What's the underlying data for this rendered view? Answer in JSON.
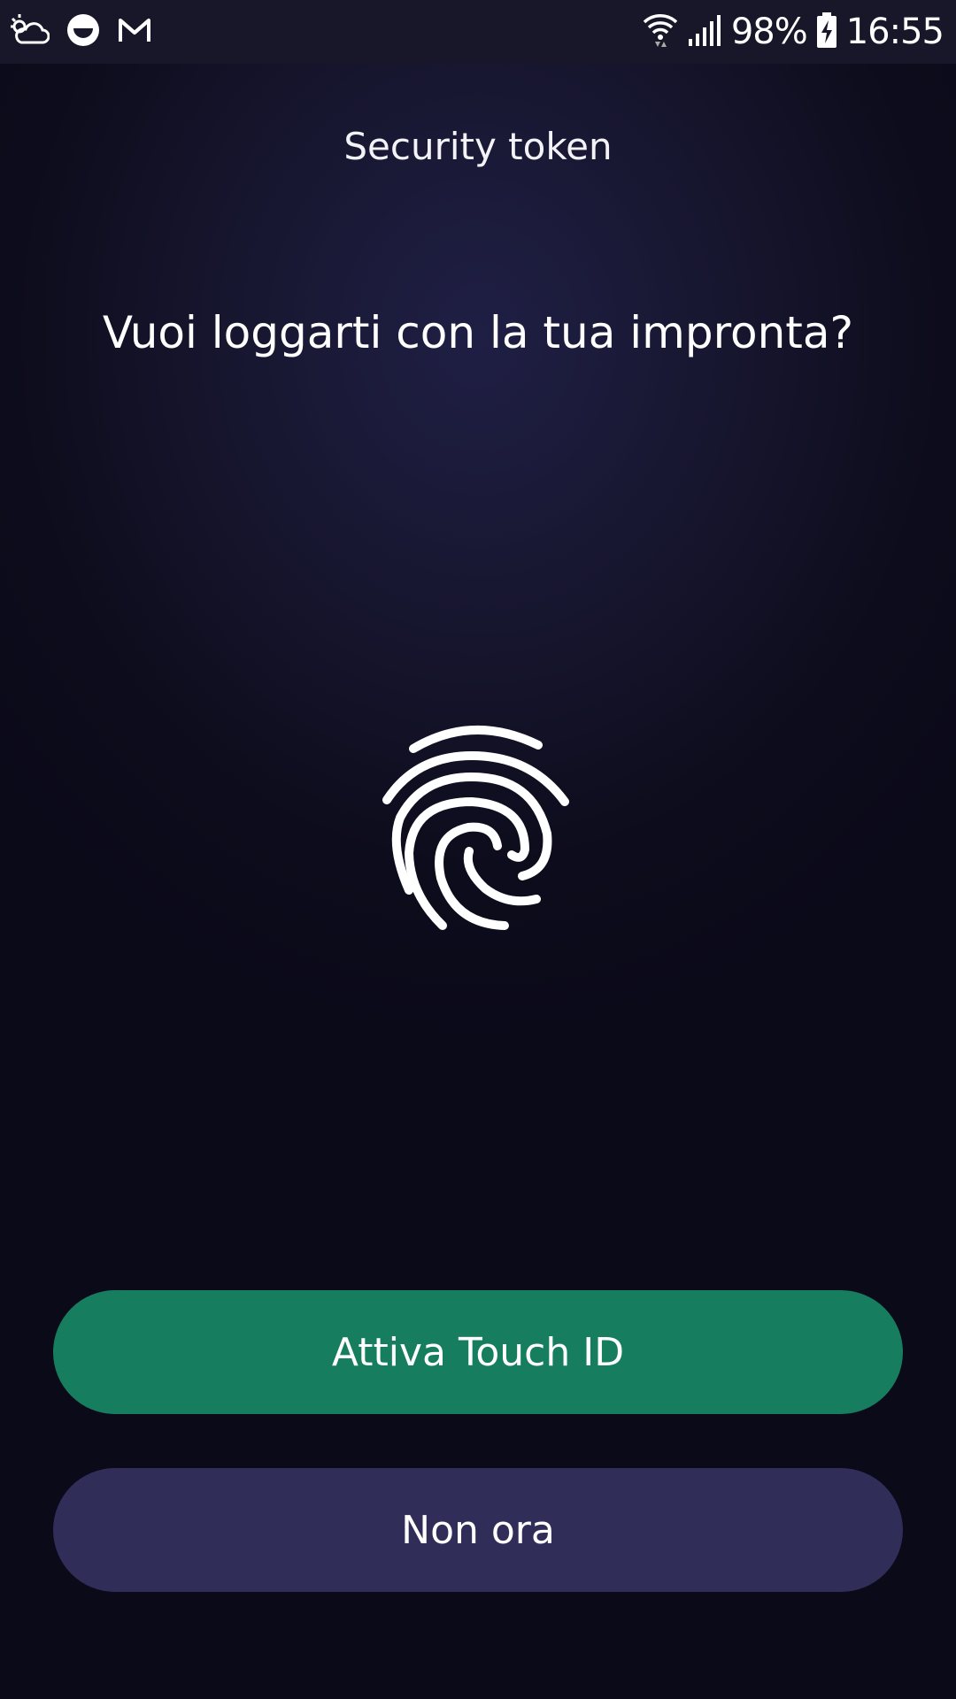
{
  "status_bar": {
    "battery": "98%",
    "time": "16:55",
    "left_icons": [
      "weather-icon",
      "smiley-icon",
      "gmail-icon"
    ],
    "right_icons": [
      "wifi-icon",
      "signal-icon",
      "battery-charging-icon"
    ]
  },
  "screen": {
    "title": "Security token",
    "question": "Vuoi loggarti con la tua impronta?",
    "icon": "fingerprint-icon"
  },
  "buttons": {
    "primary_label": "Attiva Touch ID",
    "secondary_label": "Non ora"
  },
  "colors": {
    "background": "#0d0c1c",
    "primary_button": "#167e5f",
    "secondary_button": "#312d59",
    "text": "#ffffff"
  }
}
